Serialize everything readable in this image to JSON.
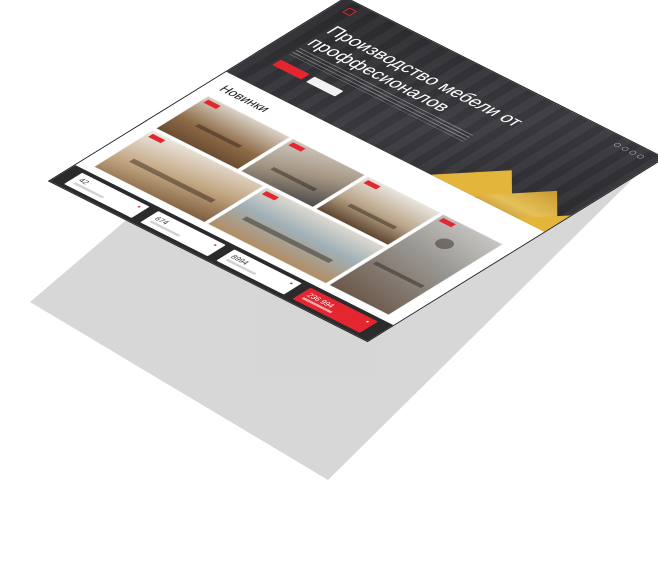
{
  "hero": {
    "title": "Производство мебели от проффесионалов",
    "nav": [
      "",
      "",
      "",
      "",
      "",
      ""
    ]
  },
  "new_section": {
    "title": "Новинки"
  },
  "stats": [
    {
      "value": "42"
    },
    {
      "value": "674"
    },
    {
      "value": "8994"
    },
    {
      "value": "236 994"
    }
  ],
  "colors": {
    "accent": "#e3262f",
    "hero_bg": "#2f2f33",
    "gold": "#e3b53a",
    "stats_bg": "#2b2b2e"
  }
}
